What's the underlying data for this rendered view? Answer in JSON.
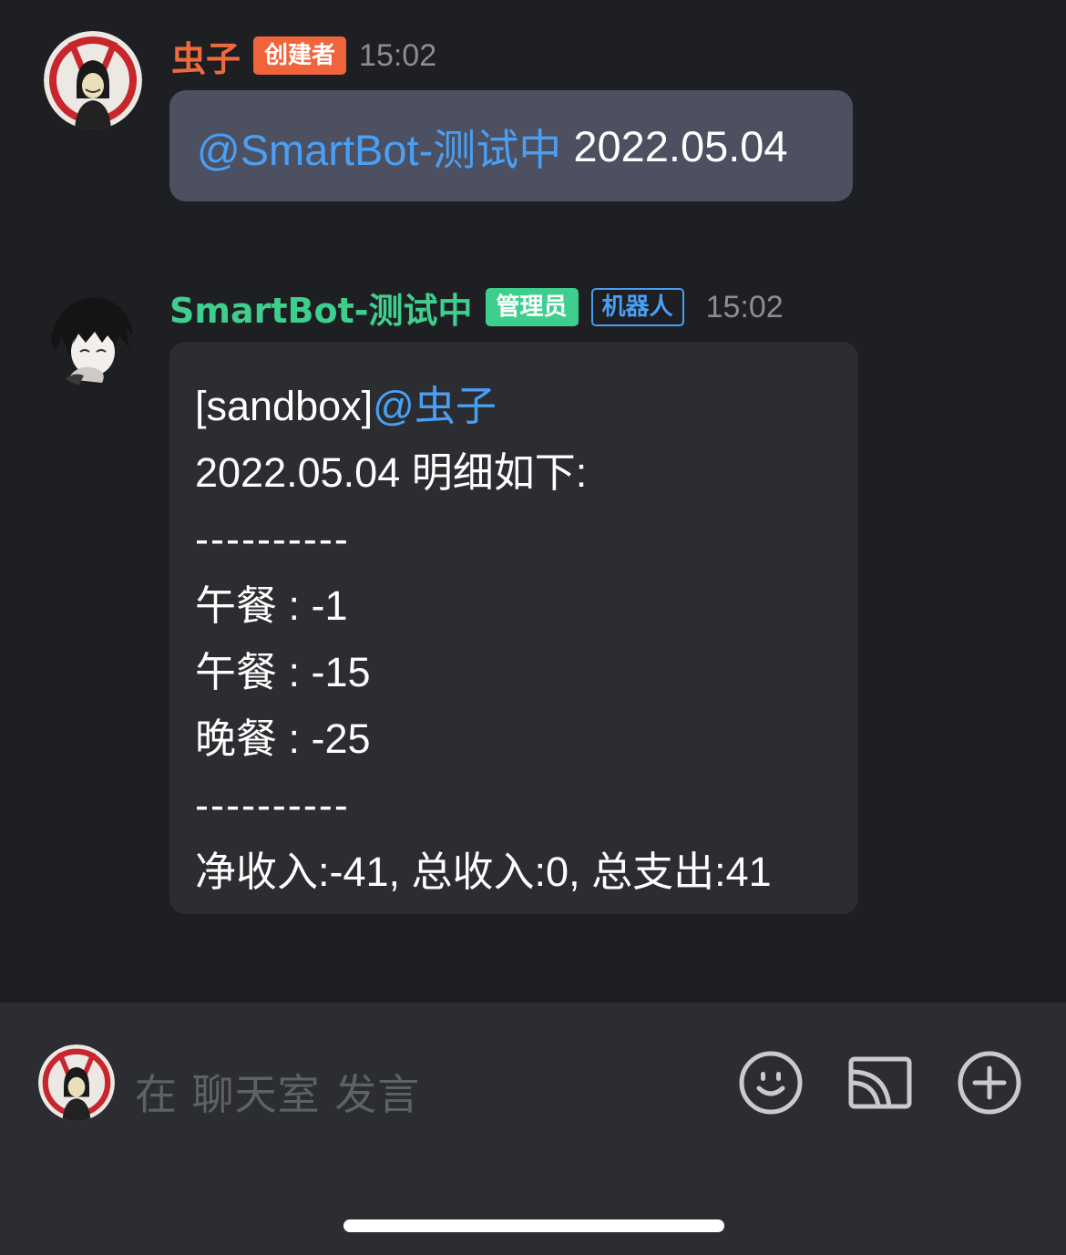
{
  "messages": [
    {
      "username": "虫子",
      "badge": "创建者",
      "time": "15:02",
      "mention": "@SmartBot-测试中",
      "text": " 2022.05.04"
    },
    {
      "username": "SmartBot-测试中",
      "badges": [
        "管理员",
        "机器人"
      ],
      "time": "15:02",
      "prefix": "[sandbox]",
      "mention": "@虫子",
      "lines": [
        "2022.05.04 明细如下:",
        "----------",
        "午餐 : -1",
        "午餐 : -15",
        "晚餐 : -25",
        "----------",
        "净收入:-41, 总收入:0, 总支出:41"
      ]
    }
  ],
  "composer": {
    "placeholder": "在 聊天室 发言",
    "icons": [
      "emoji-icon",
      "screen-cast-icon",
      "add-icon"
    ]
  },
  "colors": {
    "background": "#1e1f22",
    "creator_name": "#f06a3c",
    "creator_badge": "#f0643c",
    "bot_name": "#3ecf8e",
    "admin_badge": "#3ecf8e",
    "bot_badge_border": "#4a9ff5",
    "mention": "#4a9ff5"
  }
}
